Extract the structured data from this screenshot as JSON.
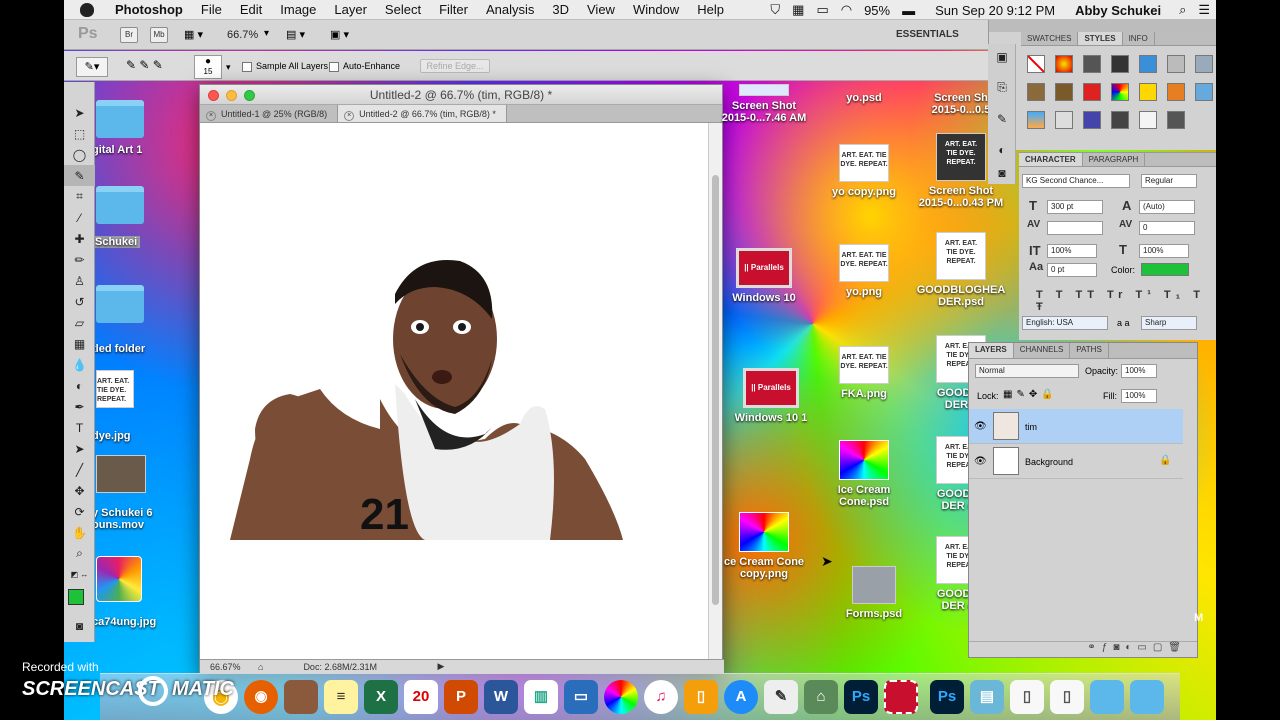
{
  "menubar": {
    "app": "Photoshop",
    "items": [
      "File",
      "Edit",
      "Image",
      "Layer",
      "Select",
      "Filter",
      "Analysis",
      "3D",
      "View",
      "Window",
      "Help"
    ],
    "battery": "95%",
    "datetime": "Sun Sep 20  9:12 PM",
    "user": "Abby Schukei"
  },
  "appbar": {
    "logo": "Ps",
    "br": "Br",
    "mb": "Mb",
    "zoom": "66.7%",
    "workspace": "ESSENTIALS"
  },
  "options": {
    "brush_size": "15",
    "sample_all_layers": "Sample All Layers",
    "auto_enhance": "Auto-Enhance",
    "refine_edge": "Refine Edge..."
  },
  "desktop_left": [
    "gital Art 1",
    "Schukei",
    "tled folder",
    "dye.jpg",
    "y Schukei 6\nouns.mov",
    "ca74ung.jpg"
  ],
  "desktop_left_thumb": "ART. EAT.\nTIE DYE.\nREPEAT.",
  "desktop_right": [
    {
      "label": "Screen Shot\n2015-0...7.46 AM"
    },
    {
      "label": "yo.psd"
    },
    {
      "label": "Screen Sh\n2015-0...0.5"
    },
    {
      "label": "yo copy.png"
    },
    {
      "label": "Screen Shot\n2015-0...0.43 PM"
    },
    {
      "label": "Windows 10"
    },
    {
      "label": "yo.png"
    },
    {
      "label": "GOODBLOGHEA\nDER.psd"
    },
    {
      "label": "Windows 10 1"
    },
    {
      "label": "FKA.png"
    },
    {
      "label": "GOODBL\nDER.c"
    },
    {
      "label": "Ice Cream\nCone.psd"
    },
    {
      "label": "GOODBL\nDER co"
    },
    {
      "label": "ce Cream Cone\ncopy.png"
    },
    {
      "label": "Forms.psd"
    },
    {
      "label": "GOODBL\nDER co"
    }
  ],
  "parallels": "|| Parallels",
  "doc": {
    "title": "Untitled-2 @ 66.7% (tim, RGB/8) *",
    "tabs": [
      "Untitled-1 @ 25% (RGB/8)",
      "Untitled-2 @ 66.7% (tim, RGB/8) *"
    ],
    "zoom": "66.67%",
    "docsize": "Doc: 2.68M/2.31M"
  },
  "photo": {
    "jersey_number": "21"
  },
  "swatches_tabs": [
    "SWATCHES",
    "STYLES",
    "INFO"
  ],
  "character": {
    "tabs": [
      "CHARACTER",
      "PARAGRAPH"
    ],
    "font": "KG Second Chance...",
    "style": "Regular",
    "size": "300 pt",
    "leading": "(Auto)",
    "tracking": "0",
    "vscale": "100%",
    "hscale": "100%",
    "baseline": "0 pt",
    "color_label": "Color:",
    "color": "#1ec23a",
    "lang": "English: USA",
    "aa": "Sharp",
    "aa_label": "a a"
  },
  "layers": {
    "tabs": [
      "LAYERS",
      "CHANNELS",
      "PATHS"
    ],
    "blend": "Normal",
    "opacity_label": "Opacity:",
    "opacity": "100%",
    "lock_label": "Lock:",
    "fill_label": "Fill:",
    "fill": "100%",
    "items": [
      "tim",
      "Background"
    ]
  },
  "watermark": {
    "line1": "Recorded with",
    "line2": "SCREENCAST",
    "line3": "MATIC"
  },
  "right_edge": "M"
}
